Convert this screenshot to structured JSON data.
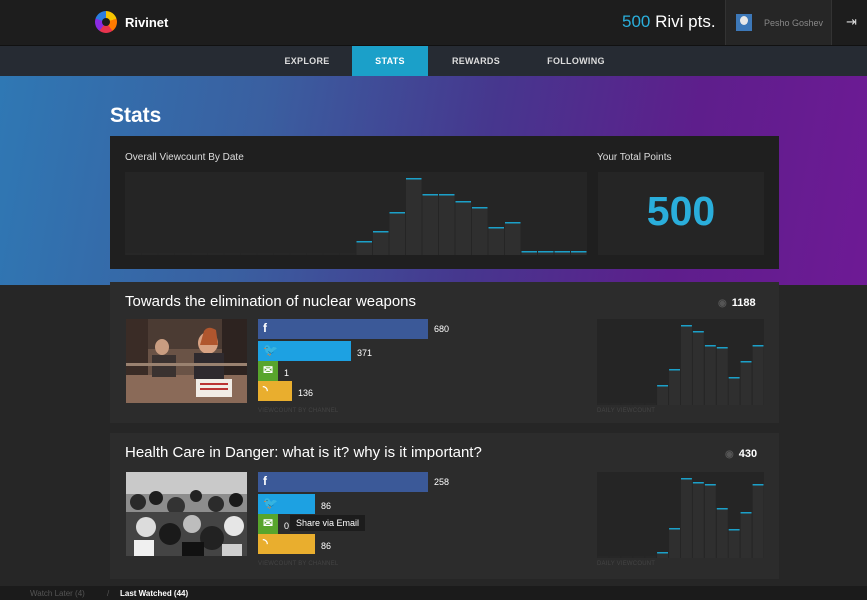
{
  "app": {
    "name": "Rivinet",
    "logo_icon": "rivinet-logo-icon"
  },
  "header": {
    "points_value": "500",
    "points_label": " Rivi pts.",
    "user_name": "Pesho Goshev",
    "logout_icon": "logout-icon"
  },
  "nav": {
    "tabs": [
      {
        "label": "EXPLORE",
        "active": false
      },
      {
        "label": "STATS",
        "active": true
      },
      {
        "label": "REWARDS",
        "active": false
      },
      {
        "label": "FOLLOWING",
        "active": false
      }
    ]
  },
  "page": {
    "title": "Stats"
  },
  "overview": {
    "viewcount_label": "Overall Viewcount By Date",
    "total_label": "Your Total Points",
    "total_value": "500",
    "daily_levels": [
      0,
      0,
      0,
      0,
      0,
      0,
      0,
      0,
      0,
      0,
      0,
      0,
      0,
      0,
      0.16,
      0.28,
      0.53,
      0.98,
      0.77,
      0.76,
      0.68,
      0.6,
      0.34,
      0.4,
      0.02,
      0.02,
      0.02,
      0.02
    ]
  },
  "accent_color": "#1ba0c9",
  "channel_colors": {
    "facebook": "#3b5998",
    "twitter": "#1da1e2",
    "email": "#58a52c",
    "rss": "#e9ae2e"
  },
  "videos": [
    {
      "title": "Towards the elimination of nuclear weapons",
      "views": "1188",
      "channels": [
        {
          "name": "facebook",
          "icon": "f",
          "value": "680",
          "count": 680
        },
        {
          "name": "twitter",
          "icon": "🐦",
          "value": "371",
          "count": 371
        },
        {
          "name": "email",
          "icon": "✉",
          "value": "1",
          "count": 1
        },
        {
          "name": "rss",
          "icon": "◝",
          "value": "136",
          "count": 136
        }
      ],
      "caption_channel": "VIEWCOUNT BY CHANNEL",
      "caption_daily": "DAILY VIEWCOUNT",
      "daily_levels": [
        0,
        0,
        0,
        0,
        0,
        0.22,
        0.42,
        0.98,
        0.9,
        0.72,
        0.7,
        0.32,
        0.53,
        0.72
      ]
    },
    {
      "title": "Health Care in Danger: what is it? why is it important?",
      "views": "430",
      "channels": [
        {
          "name": "facebook",
          "icon": "f",
          "value": "258",
          "count": 258
        },
        {
          "name": "twitter",
          "icon": "🐦",
          "value": "86",
          "count": 86
        },
        {
          "name": "email",
          "icon": "✉",
          "value": "0",
          "count": 0,
          "tooltip": "Share via Email"
        },
        {
          "name": "rss",
          "icon": "◝",
          "value": "86",
          "count": 86
        }
      ],
      "caption_channel": "VIEWCOUNT BY CHANNEL",
      "caption_daily": "DAILY VIEWCOUNT",
      "daily_levels": [
        0,
        0,
        0,
        0,
        0,
        0.05,
        0.35,
        0.98,
        0.92,
        0.9,
        0.6,
        0.34,
        0.55,
        0.9
      ]
    }
  ],
  "footer": {
    "watch_later": "Watch Later (4)",
    "separator": "/",
    "last_watched": "Last Watched (44)"
  }
}
